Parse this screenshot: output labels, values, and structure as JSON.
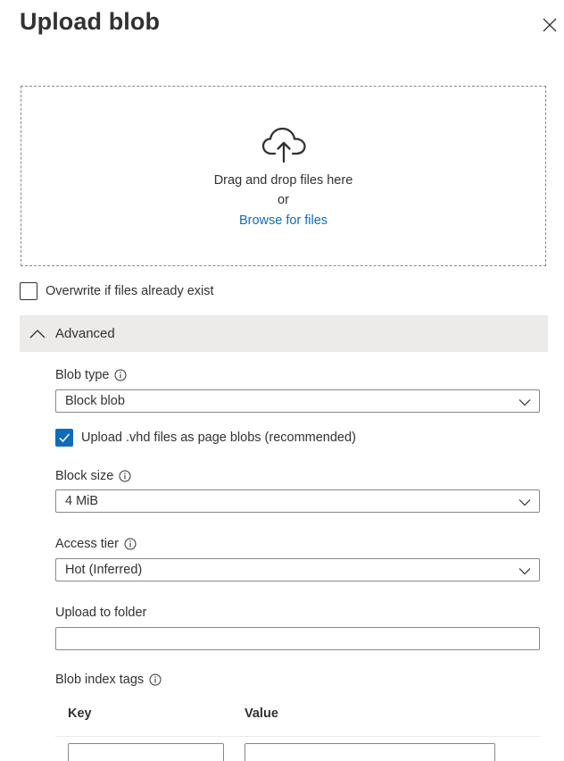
{
  "panel": {
    "title": "Upload blob"
  },
  "dropzone": {
    "drag_text": "Drag and drop files here",
    "or_text": "or",
    "browse_text": "Browse for files"
  },
  "overwrite": {
    "label": "Overwrite if files already exist",
    "checked": false
  },
  "advanced": {
    "label": "Advanced",
    "expanded": true,
    "blob_type": {
      "label": "Blob type",
      "value": "Block blob"
    },
    "vhd_option": {
      "label": "Upload .vhd files as page blobs (recommended)",
      "checked": true
    },
    "block_size": {
      "label": "Block size",
      "value": "4 MiB"
    },
    "access_tier": {
      "label": "Access tier",
      "value": "Hot (Inferred)"
    },
    "upload_folder": {
      "label": "Upload to folder",
      "value": ""
    },
    "index_tags": {
      "label": "Blob index tags",
      "columns": [
        "Key",
        "Value"
      ],
      "rows": [
        {
          "key": "",
          "value": ""
        }
      ]
    }
  },
  "colors": {
    "accent": "#0f6cbd",
    "text": "#323130",
    "border": "#8a8886",
    "section_bg": "#edebe9"
  },
  "icons": [
    "close-icon",
    "cloud-upload-icon",
    "chevron-up-icon",
    "info-icon",
    "chevron-down-icon",
    "checkmark-icon"
  ]
}
